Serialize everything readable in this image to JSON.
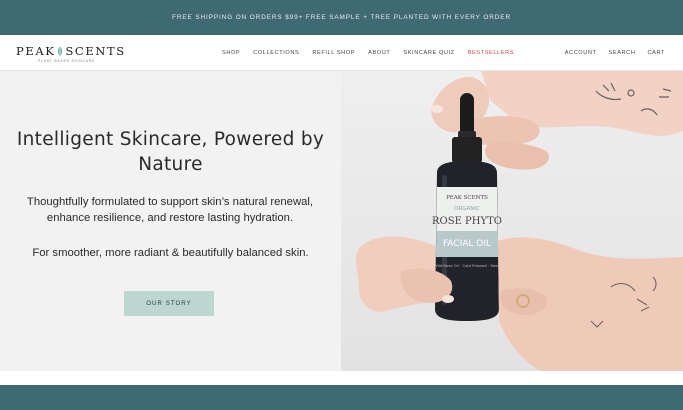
{
  "announcement": {
    "text": "FREE SHIPPING ON ORDERS $99+ FREE SAMPLE + TREE PLANTED WITH EVERY ORDER"
  },
  "header": {
    "logo": {
      "word_left": "PEAK",
      "word_right": "SCENTS",
      "tagline": "PLANT BASED SKINCARE"
    },
    "nav": [
      {
        "label": "SHOP"
      },
      {
        "label": "COLLECTIONS"
      },
      {
        "label": "REFILL SHOP"
      },
      {
        "label": "ABOUT"
      },
      {
        "label": "SKINCARE QUIZ"
      },
      {
        "label": "BESTSELLERS"
      }
    ],
    "utility": [
      {
        "label": "ACCOUNT"
      },
      {
        "label": "SEARCH"
      },
      {
        "label": "CART"
      }
    ]
  },
  "hero": {
    "title": "Intelligent Skincare, Powered by Nature",
    "paragraph": "Thoughtfully formulated to support skin’s natural renewal, enhance resilience, and restore lasting hydration.",
    "paragraph2": "For smoother, more radiant & beautifully balanced skin.",
    "cta_label": "OUR STORY",
    "image": {
      "bottle_brand": "PEAK SCENTS",
      "bottle_line1": "ORGANIC",
      "bottle_line2": "ROSE PHYTO",
      "bottle_line3": "FACIAL OIL",
      "bottle_small": "Wild Rose Oil · Cold Pressed · Seed"
    }
  },
  "colors": {
    "accent_teal": "#3f6a72",
    "cta_bg": "#bcd7cf",
    "highlight_red": "#c74a4a"
  }
}
